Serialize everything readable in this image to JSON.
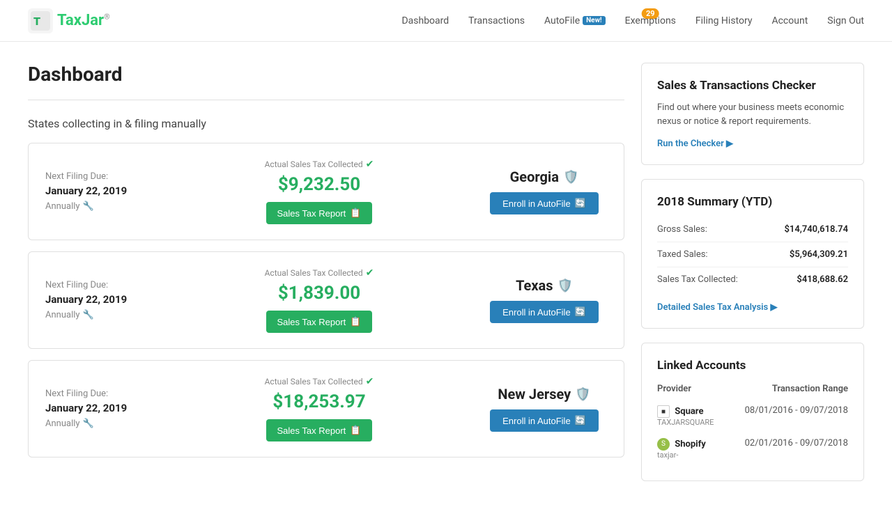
{
  "nav": {
    "logo_text": "TaxJar",
    "links": [
      {
        "id": "dashboard",
        "label": "Dashboard",
        "badge": null
      },
      {
        "id": "transactions",
        "label": "Transactions",
        "badge": null
      },
      {
        "id": "autofile",
        "label": "AutoFile",
        "badge": "New!"
      },
      {
        "id": "exemptions",
        "label": "Exemptions",
        "badge": "29"
      },
      {
        "id": "filing-history",
        "label": "Filing History",
        "badge": null
      },
      {
        "id": "account",
        "label": "Account",
        "badge": null
      },
      {
        "id": "sign-out",
        "label": "Sign Out",
        "badge": null
      }
    ]
  },
  "page": {
    "title": "Dashboard",
    "section_label": "States collecting in & filing manually"
  },
  "states": [
    {
      "id": "georgia",
      "filing_due_label": "Next Filing Due:",
      "filing_date": "January 22, 2019",
      "frequency": "Annually",
      "tax_label": "Actual Sales Tax Collected",
      "tax_amount": "$9,232.50",
      "report_btn": "Sales Tax Report",
      "state_name": "Georgia",
      "autofile_btn": "Enroll in AutoFile"
    },
    {
      "id": "texas",
      "filing_due_label": "Next Filing Due:",
      "filing_date": "January 22, 2019",
      "frequency": "Annually",
      "tax_label": "Actual Sales Tax Collected",
      "tax_amount": "$1,839.00",
      "report_btn": "Sales Tax Report",
      "state_name": "Texas",
      "autofile_btn": "Enroll in AutoFile"
    },
    {
      "id": "new-jersey",
      "filing_due_label": "Next Filing Due:",
      "filing_date": "January 22, 2019",
      "frequency": "Annually",
      "tax_label": "Actual Sales Tax Collected",
      "tax_amount": "$18,253.97",
      "report_btn": "Sales Tax Report",
      "state_name": "New Jersey",
      "autofile_btn": "Enroll in AutoFile"
    }
  ],
  "checker": {
    "title": "Sales & Transactions Checker",
    "description": "Find out where your business meets economic nexus or notice & report requirements.",
    "link_label": "Run the Checker ▶"
  },
  "summary": {
    "title": "2018 Summary (YTD)",
    "rows": [
      {
        "label": "Gross Sales:",
        "value": "$14,740,618.74"
      },
      {
        "label": "Taxed Sales:",
        "value": "$5,964,309.21"
      },
      {
        "label": "Sales Tax Collected:",
        "value": "$418,688.62"
      }
    ],
    "link_label": "Detailed Sales Tax Analysis ▶"
  },
  "linked_accounts": {
    "title": "Linked Accounts",
    "col_provider": "Provider",
    "col_range": "Transaction Range",
    "accounts": [
      {
        "id": "square",
        "name": "Square",
        "sub": "TAXJARSQUARE",
        "range": "08/01/2016 - 09/07/2018",
        "icon_type": "square"
      },
      {
        "id": "shopify",
        "name": "Shopify",
        "sub": "taxjar-",
        "range": "02/01/2016 - 09/07/2018",
        "icon_type": "shopify"
      }
    ]
  }
}
